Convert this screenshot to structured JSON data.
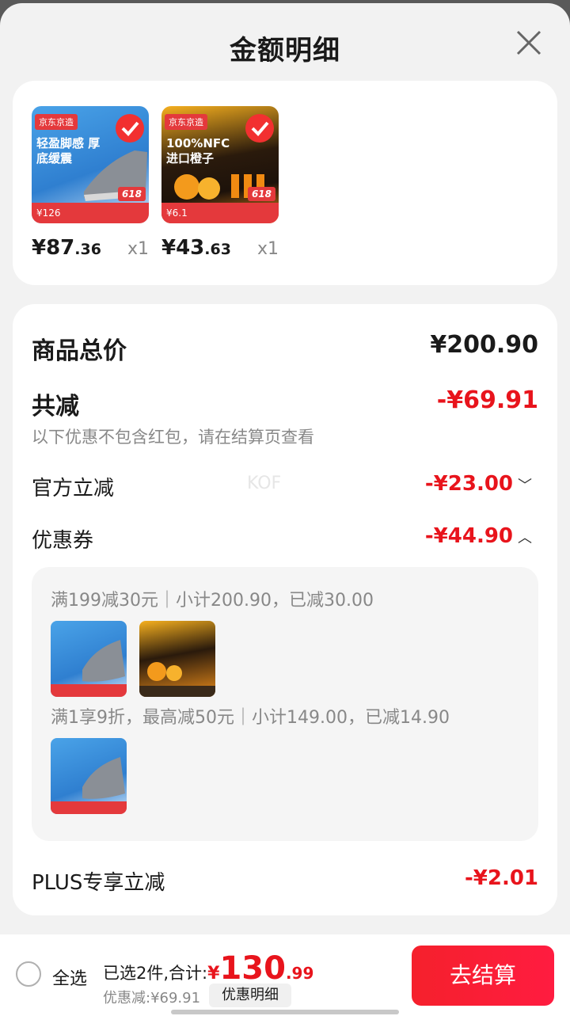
{
  "header": {
    "title": "金额明细"
  },
  "products": [
    {
      "shop_badge": "京东京造",
      "thumb_text": "轻盈脚感 厚底缓震",
      "thumb_price": "¥126",
      "promo": "618",
      "price_main": "¥87",
      "price_decimal": ".36",
      "qty": "x1"
    },
    {
      "shop_badge": "京东京造",
      "thumb_text": "100%NFC 进口橙子",
      "thumb_price": "¥6.1",
      "promo": "618",
      "price_main": "¥43",
      "price_decimal": ".63",
      "qty": "x1"
    }
  ],
  "summary": {
    "total_label": "商品总价",
    "total_value": "¥200.90",
    "discount_label": "共减",
    "discount_value": "-¥69.91",
    "discount_note": "以下优惠不包含红包，请在结算页查看",
    "official_label": "官方立减",
    "official_value": "-¥23.00",
    "watermark": "KOF",
    "coupon_label": "优惠券",
    "coupon_value": "-¥44.90",
    "coupon_line1": "满199减30元｜小计200.90，已减30.00",
    "coupon_line2": "满1享9折，最高减50元｜小计149.00，已减14.90",
    "plus_label": "PLUS专享立减",
    "plus_value": "-¥2.01"
  },
  "bottom_bar": {
    "select_all": "全选",
    "selected_text": "已选2件,合计:",
    "currency": "¥",
    "total_int": "130",
    "total_dec": ".99",
    "discount_text": "优惠减:¥69.91",
    "detail_button": "优惠明细",
    "checkout_button": "去结算"
  },
  "colors": {
    "accent": "#e8141c",
    "button": "#f5202c"
  }
}
